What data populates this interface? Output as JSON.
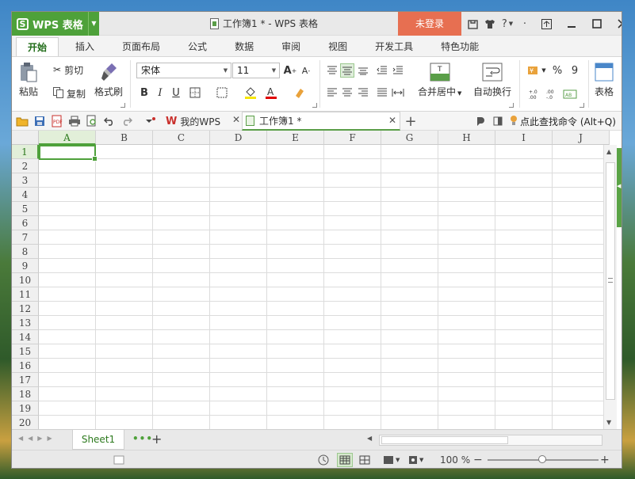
{
  "app": {
    "logo_label": "WPS 表格",
    "document_title": "工作簿1 * - WPS 表格",
    "login_label": "未登录",
    "help_label": "?"
  },
  "ribbon_tabs": [
    "开始",
    "插入",
    "页面布局",
    "公式",
    "数据",
    "审阅",
    "视图",
    "开发工具",
    "特色功能"
  ],
  "ribbon": {
    "paste": "粘贴",
    "cut": "剪切",
    "copy": "复制",
    "format_painter": "格式刷",
    "font_name": "宋体",
    "font_size": "11",
    "bold": "B",
    "italic": "I",
    "underline": "U",
    "merge_center": "合并居中",
    "wrap_text": "自动换行",
    "percent": "%",
    "comma": "9",
    "table_label": "表格"
  },
  "doc_tabs": [
    {
      "label": "我的WPS"
    },
    {
      "label": "工作簿1 *"
    }
  ],
  "search_hint": "点此查找命令 (Alt+Q)",
  "grid": {
    "columns": [
      "A",
      "B",
      "C",
      "D",
      "E",
      "F",
      "G",
      "H",
      "I",
      "J"
    ],
    "rows": [
      "1",
      "2",
      "3",
      "4",
      "5",
      "6",
      "7",
      "8",
      "9",
      "10",
      "11",
      "12",
      "13",
      "14",
      "15",
      "16",
      "17",
      "18",
      "19",
      "20"
    ],
    "active_cell": "A1"
  },
  "sheets": [
    {
      "label": "Sheet1"
    }
  ],
  "status": {
    "zoom": "100 %"
  },
  "colors": {
    "accent": "#4ea13a",
    "login": "#e76f51"
  }
}
